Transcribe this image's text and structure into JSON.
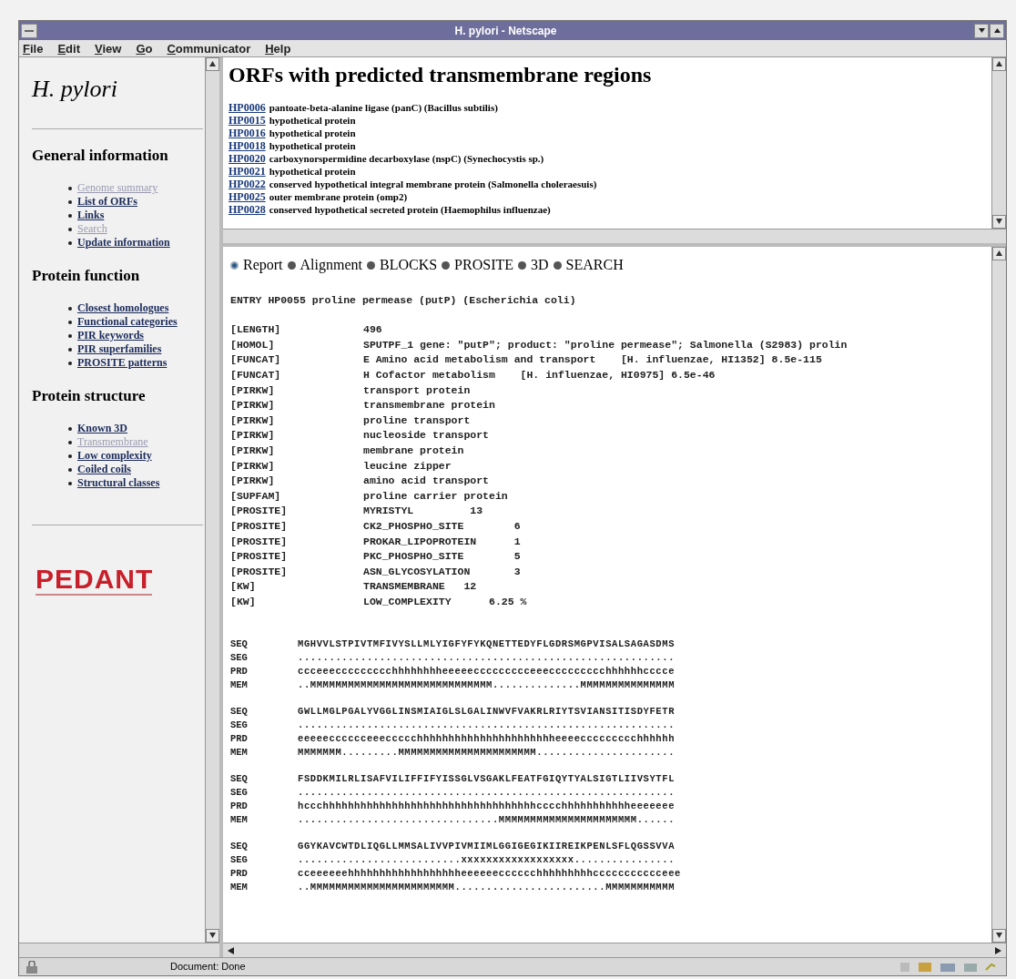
{
  "window": {
    "title": "H. pylori - Netscape"
  },
  "menu": [
    "File",
    "Edit",
    "View",
    "Go",
    "Communicator",
    "Help"
  ],
  "sidebar": {
    "title": "H. pylori",
    "sections": [
      {
        "heading": "General information",
        "links": [
          {
            "label": "Genome summary",
            "visited": true
          },
          {
            "label": "List of ORFs",
            "visited": false
          },
          {
            "label": "Links",
            "visited": false
          },
          {
            "label": "Search",
            "visited": true
          },
          {
            "label": "Update information",
            "visited": false
          }
        ]
      },
      {
        "heading": "Protein function",
        "links": [
          {
            "label": "Closest homologues",
            "visited": false
          },
          {
            "label": "Functional categories",
            "visited": false
          },
          {
            "label": "PIR keywords",
            "visited": false
          },
          {
            "label": "PIR superfamilies",
            "visited": false
          },
          {
            "label": "PROSITE patterns",
            "visited": false
          }
        ]
      },
      {
        "heading": "Protein structure",
        "links": [
          {
            "label": "Known 3D",
            "visited": false
          },
          {
            "label": "Transmembrane",
            "visited": true
          },
          {
            "label": "Low complexity",
            "visited": false
          },
          {
            "label": "Coiled coils",
            "visited": false
          },
          {
            "label": "Structural classes",
            "visited": false
          }
        ]
      }
    ],
    "logo": "PEDANT"
  },
  "orf_frame": {
    "heading": "ORFs with predicted transmembrane regions",
    "orfs": [
      {
        "id": "HP0006",
        "description": "pantoate-beta-alanine ligase (panC) (Bacillus subtilis)"
      },
      {
        "id": "HP0015",
        "description": "hypothetical protein"
      },
      {
        "id": "HP0016",
        "description": "hypothetical protein"
      },
      {
        "id": "HP0018",
        "description": "hypothetical protein"
      },
      {
        "id": "HP0020",
        "description": "carboxynorspermidine decarboxylase (nspC) (Synechocystis sp.)"
      },
      {
        "id": "HP0021",
        "description": "hypothetical protein"
      },
      {
        "id": "HP0022",
        "description": "conserved hypothetical integral membrane protein (Salmonella choleraesuis)"
      },
      {
        "id": "HP0025",
        "description": "outer membrane protein (omp2)"
      },
      {
        "id": "HP0028",
        "description": "conserved hypothetical secreted protein (Haemophilus influenzae)"
      }
    ]
  },
  "report_frame": {
    "tabs": [
      {
        "label": "Report",
        "selected": true
      },
      {
        "label": "Alignment",
        "selected": false
      },
      {
        "label": "BLOCKS",
        "selected": false
      },
      {
        "label": "PROSITE",
        "selected": false
      },
      {
        "label": "3D",
        "selected": false
      },
      {
        "label": "SEARCH",
        "selected": false
      }
    ],
    "entry": "ENTRY HP0055 proline permease (putP) (Escherichia coli)",
    "fields": [
      {
        "tag": "[LENGTH]",
        "value": "496"
      },
      {
        "tag": "[HOMOL]",
        "value": "SPUTPF_1 gene: \"putP\"; product: \"proline permease\"; Salmonella (S2983) prolin"
      },
      {
        "tag": "[FUNCAT]",
        "value": "E Amino acid metabolism and transport    [H. influenzae, HI1352] 8.5e-115"
      },
      {
        "tag": "[FUNCAT]",
        "value": "H Cofactor metabolism    [H. influenzae, HI0975] 6.5e-46"
      },
      {
        "tag": "[PIRKW]",
        "value": "transport protein"
      },
      {
        "tag": "[PIRKW]",
        "value": "transmembrane protein"
      },
      {
        "tag": "[PIRKW]",
        "value": "proline transport"
      },
      {
        "tag": "[PIRKW]",
        "value": "nucleoside transport"
      },
      {
        "tag": "[PIRKW]",
        "value": "membrane protein"
      },
      {
        "tag": "[PIRKW]",
        "value": "leucine zipper"
      },
      {
        "tag": "[PIRKW]",
        "value": "amino acid transport"
      },
      {
        "tag": "[SUPFAM]",
        "value": "proline carrier protein"
      },
      {
        "tag": "[PROSITE]",
        "value": "MYRISTYL         13"
      },
      {
        "tag": "[PROSITE]",
        "value": "CK2_PHOSPHO_SITE        6"
      },
      {
        "tag": "[PROSITE]",
        "value": "PROKAR_LIPOPROTEIN      1"
      },
      {
        "tag": "[PROSITE]",
        "value": "PKC_PHOSPHO_SITE        5"
      },
      {
        "tag": "[PROSITE]",
        "value": "ASN_GLYCOSYLATION       3"
      },
      {
        "tag": "[KW]",
        "value": "TRANSMEMBRANE   12"
      },
      {
        "tag": "[KW]",
        "value": "LOW_COMPLEXITY      6.25 %"
      }
    ],
    "blocks": [
      [
        {
          "label": "SEQ",
          "text": "MGHVVLSTPIVTMFIVYSLLMLYIGFYFYKQNETTEDYFLGDRSMGPVISALSAGASDMS"
        },
        {
          "label": "SEG",
          "text": "............................................................"
        },
        {
          "label": "PRD",
          "text": "ccceeeccccccccchhhhhhhheeeeeccccccccceeeccccccccchhhhhhcccce"
        },
        {
          "label": "MEM",
          "text": "..MMMMMMMMMMMMMMMMMMMMMMMMMMMMM..............MMMMMMMMMMMMMMM"
        }
      ],
      [
        {
          "label": "SEQ",
          "text": "GWLLMGLPGALYVGGLINSMIAIGLSLGALINWVFVAKRLRIYTSVIANSITISDYFETR"
        },
        {
          "label": "SEG",
          "text": "............................................................"
        },
        {
          "label": "PRD",
          "text": "eeeeecccccceeeccccchhhhhhhhhhhhhhhhhhhhhheeeeccccccccchhhhhh"
        },
        {
          "label": "MEM",
          "text": "MMMMMMM.........MMMMMMMMMMMMMMMMMMMMMM......................"
        }
      ],
      [
        {
          "label": "SEQ",
          "text": "FSDDKMILRLISAFVILIFFIFYISSGLVSGAKLFEATFGIQYTYALSIGTLIIVSYTFL"
        },
        {
          "label": "SEG",
          "text": "............................................................"
        },
        {
          "label": "PRD",
          "text": "hccchhhhhhhhhhhhhhhhhhhhhhhhhhhhhhhhhhcccchhhhhhhhhhheeeeeee"
        },
        {
          "label": "MEM",
          "text": "................................MMMMMMMMMMMMMMMMMMMMMM......"
        }
      ],
      [
        {
          "label": "SEQ",
          "text": "GGYKAVCWTDLIQGLLMMSALIVVPIVMIIMLGGIGEGIKIIREIKPENLSFLQGSSVVA"
        },
        {
          "label": "SEG",
          "text": "..........................xxxxxxxxxxxxxxxxxx................"
        },
        {
          "label": "PRD",
          "text": "cceeeeeehhhhhhhhhhhhhhhhhheeeeeecccccchhhhhhhhhccccccccccceee"
        },
        {
          "label": "MEM",
          "text": "..MMMMMMMMMMMMMMMMMMMMMMM........................MMMMMMMMMMM"
        }
      ]
    ]
  },
  "status_bar": {
    "text": "Document: Done"
  }
}
